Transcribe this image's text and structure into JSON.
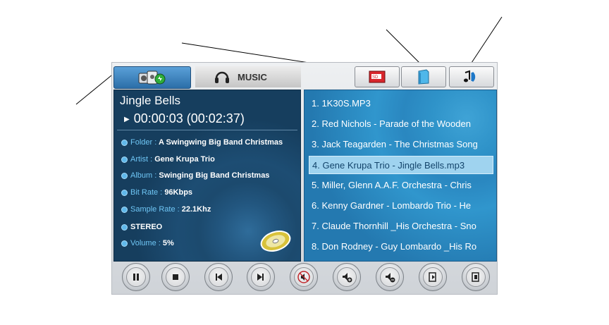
{
  "tabs": {
    "home_icon": "home-devices-icon",
    "music_label": "MUSIC",
    "sources": [
      "sd-card-icon",
      "folder-icon",
      "music-library-icon"
    ]
  },
  "now_playing": {
    "title": "Jingle Bells",
    "time": "00:00:03 (00:02:37)",
    "folder_label": "Folder :",
    "folder": "A Swingwing Big Band Christmas",
    "artist_label": "Artist :",
    "artist": "Gene Krupa Trio",
    "album_label": "Album :",
    "album": "Swinging Big Band Christmas",
    "bitrate_label": "Bit Rate :",
    "bitrate": "96Kbps",
    "samplerate_label": "Sample Rate :",
    "samplerate": "22.1Khz",
    "mode": "STEREO",
    "volume_label": "Volume :",
    "volume": "5%"
  },
  "playlist": {
    "items": [
      "1. 1K30S.MP3",
      "2. Red Nichols - Parade of the Wooden",
      "3. Jack Teagarden - The Christmas Song",
      "4. Gene Krupa Trio - Jingle Bells.mp3",
      "5. Miller, Glenn A.A.F. Orchestra - Chris",
      "6. Kenny Gardner - Lombardo Trio - He",
      "7. Claude Thornhill _His Orchestra - Sno",
      "8. Don Rodney - Guy Lombardo _His Ro"
    ],
    "selected_index": 3
  },
  "controls": [
    "pause-icon",
    "stop-icon",
    "previous-track-icon",
    "next-track-icon",
    "mute-icon",
    "volume-up-icon",
    "volume-down-icon",
    "repeat-icon",
    "exit-icon"
  ],
  "colors": {
    "panel_dark": "#1c4a6e",
    "playlist_blue": "#2f93c9",
    "selected_row": "#9fd3ef",
    "accent": "#2b6ea8"
  }
}
